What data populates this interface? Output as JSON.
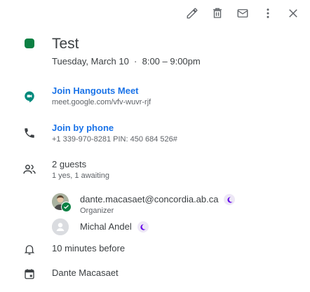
{
  "toolbar": {
    "icons": [
      "pencil-icon",
      "trash-icon",
      "mail-icon",
      "more-vert-icon",
      "close-icon"
    ]
  },
  "event": {
    "color": "#0b8043",
    "title": "Test",
    "datetime": "Tuesday, March 10  ·  8:00 – 9:00pm"
  },
  "meet": {
    "link_label": "Join Hangouts Meet",
    "url": "meet.google.com/vfv-wuvr-rjf"
  },
  "phone": {
    "link_label": "Join by phone",
    "details": "+1 339-970-8281 PIN: 450 684 526#"
  },
  "guests": {
    "summary": "2 guests",
    "status": "1 yes, 1 awaiting",
    "list": [
      {
        "name": "dante.macasaet@concordia.ab.ca",
        "role": "Organizer",
        "accepted": true
      },
      {
        "name": "Michal Andel",
        "role": "",
        "accepted": false
      }
    ]
  },
  "reminder": {
    "text": "10 minutes before"
  },
  "calendar": {
    "owner": "Dante Macasaet"
  },
  "colors": {
    "accent": "#1a73e8",
    "event_green": "#0b8043",
    "moon_purple": "#6200ea"
  }
}
